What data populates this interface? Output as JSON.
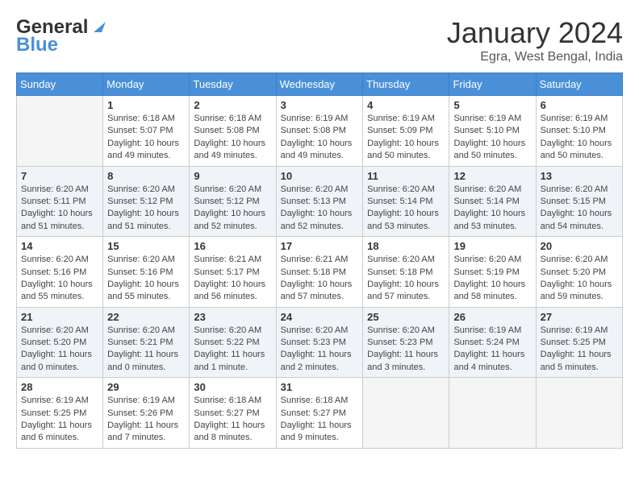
{
  "logo": {
    "line1": "General",
    "line2": "Blue"
  },
  "header": {
    "title": "January 2024",
    "location": "Egra, West Bengal, India"
  },
  "days_of_week": [
    "Sunday",
    "Monday",
    "Tuesday",
    "Wednesday",
    "Thursday",
    "Friday",
    "Saturday"
  ],
  "weeks": [
    [
      {
        "day": "",
        "info": ""
      },
      {
        "day": "1",
        "info": "Sunrise: 6:18 AM\nSunset: 5:07 PM\nDaylight: 10 hours\nand 49 minutes."
      },
      {
        "day": "2",
        "info": "Sunrise: 6:18 AM\nSunset: 5:08 PM\nDaylight: 10 hours\nand 49 minutes."
      },
      {
        "day": "3",
        "info": "Sunrise: 6:19 AM\nSunset: 5:08 PM\nDaylight: 10 hours\nand 49 minutes."
      },
      {
        "day": "4",
        "info": "Sunrise: 6:19 AM\nSunset: 5:09 PM\nDaylight: 10 hours\nand 50 minutes."
      },
      {
        "day": "5",
        "info": "Sunrise: 6:19 AM\nSunset: 5:10 PM\nDaylight: 10 hours\nand 50 minutes."
      },
      {
        "day": "6",
        "info": "Sunrise: 6:19 AM\nSunset: 5:10 PM\nDaylight: 10 hours\nand 50 minutes."
      }
    ],
    [
      {
        "day": "7",
        "info": "Sunrise: 6:20 AM\nSunset: 5:11 PM\nDaylight: 10 hours\nand 51 minutes."
      },
      {
        "day": "8",
        "info": "Sunrise: 6:20 AM\nSunset: 5:12 PM\nDaylight: 10 hours\nand 51 minutes."
      },
      {
        "day": "9",
        "info": "Sunrise: 6:20 AM\nSunset: 5:12 PM\nDaylight: 10 hours\nand 52 minutes."
      },
      {
        "day": "10",
        "info": "Sunrise: 6:20 AM\nSunset: 5:13 PM\nDaylight: 10 hours\nand 52 minutes."
      },
      {
        "day": "11",
        "info": "Sunrise: 6:20 AM\nSunset: 5:14 PM\nDaylight: 10 hours\nand 53 minutes."
      },
      {
        "day": "12",
        "info": "Sunrise: 6:20 AM\nSunset: 5:14 PM\nDaylight: 10 hours\nand 53 minutes."
      },
      {
        "day": "13",
        "info": "Sunrise: 6:20 AM\nSunset: 5:15 PM\nDaylight: 10 hours\nand 54 minutes."
      }
    ],
    [
      {
        "day": "14",
        "info": "Sunrise: 6:20 AM\nSunset: 5:16 PM\nDaylight: 10 hours\nand 55 minutes."
      },
      {
        "day": "15",
        "info": "Sunrise: 6:20 AM\nSunset: 5:16 PM\nDaylight: 10 hours\nand 55 minutes."
      },
      {
        "day": "16",
        "info": "Sunrise: 6:21 AM\nSunset: 5:17 PM\nDaylight: 10 hours\nand 56 minutes."
      },
      {
        "day": "17",
        "info": "Sunrise: 6:21 AM\nSunset: 5:18 PM\nDaylight: 10 hours\nand 57 minutes."
      },
      {
        "day": "18",
        "info": "Sunrise: 6:20 AM\nSunset: 5:18 PM\nDaylight: 10 hours\nand 57 minutes."
      },
      {
        "day": "19",
        "info": "Sunrise: 6:20 AM\nSunset: 5:19 PM\nDaylight: 10 hours\nand 58 minutes."
      },
      {
        "day": "20",
        "info": "Sunrise: 6:20 AM\nSunset: 5:20 PM\nDaylight: 10 hours\nand 59 minutes."
      }
    ],
    [
      {
        "day": "21",
        "info": "Sunrise: 6:20 AM\nSunset: 5:20 PM\nDaylight: 11 hours\nand 0 minutes."
      },
      {
        "day": "22",
        "info": "Sunrise: 6:20 AM\nSunset: 5:21 PM\nDaylight: 11 hours\nand 0 minutes."
      },
      {
        "day": "23",
        "info": "Sunrise: 6:20 AM\nSunset: 5:22 PM\nDaylight: 11 hours\nand 1 minute."
      },
      {
        "day": "24",
        "info": "Sunrise: 6:20 AM\nSunset: 5:23 PM\nDaylight: 11 hours\nand 2 minutes."
      },
      {
        "day": "25",
        "info": "Sunrise: 6:20 AM\nSunset: 5:23 PM\nDaylight: 11 hours\nand 3 minutes."
      },
      {
        "day": "26",
        "info": "Sunrise: 6:19 AM\nSunset: 5:24 PM\nDaylight: 11 hours\nand 4 minutes."
      },
      {
        "day": "27",
        "info": "Sunrise: 6:19 AM\nSunset: 5:25 PM\nDaylight: 11 hours\nand 5 minutes."
      }
    ],
    [
      {
        "day": "28",
        "info": "Sunrise: 6:19 AM\nSunset: 5:25 PM\nDaylight: 11 hours\nand 6 minutes."
      },
      {
        "day": "29",
        "info": "Sunrise: 6:19 AM\nSunset: 5:26 PM\nDaylight: 11 hours\nand 7 minutes."
      },
      {
        "day": "30",
        "info": "Sunrise: 6:18 AM\nSunset: 5:27 PM\nDaylight: 11 hours\nand 8 minutes."
      },
      {
        "day": "31",
        "info": "Sunrise: 6:18 AM\nSunset: 5:27 PM\nDaylight: 11 hours\nand 9 minutes."
      },
      {
        "day": "",
        "info": ""
      },
      {
        "day": "",
        "info": ""
      },
      {
        "day": "",
        "info": ""
      }
    ]
  ]
}
